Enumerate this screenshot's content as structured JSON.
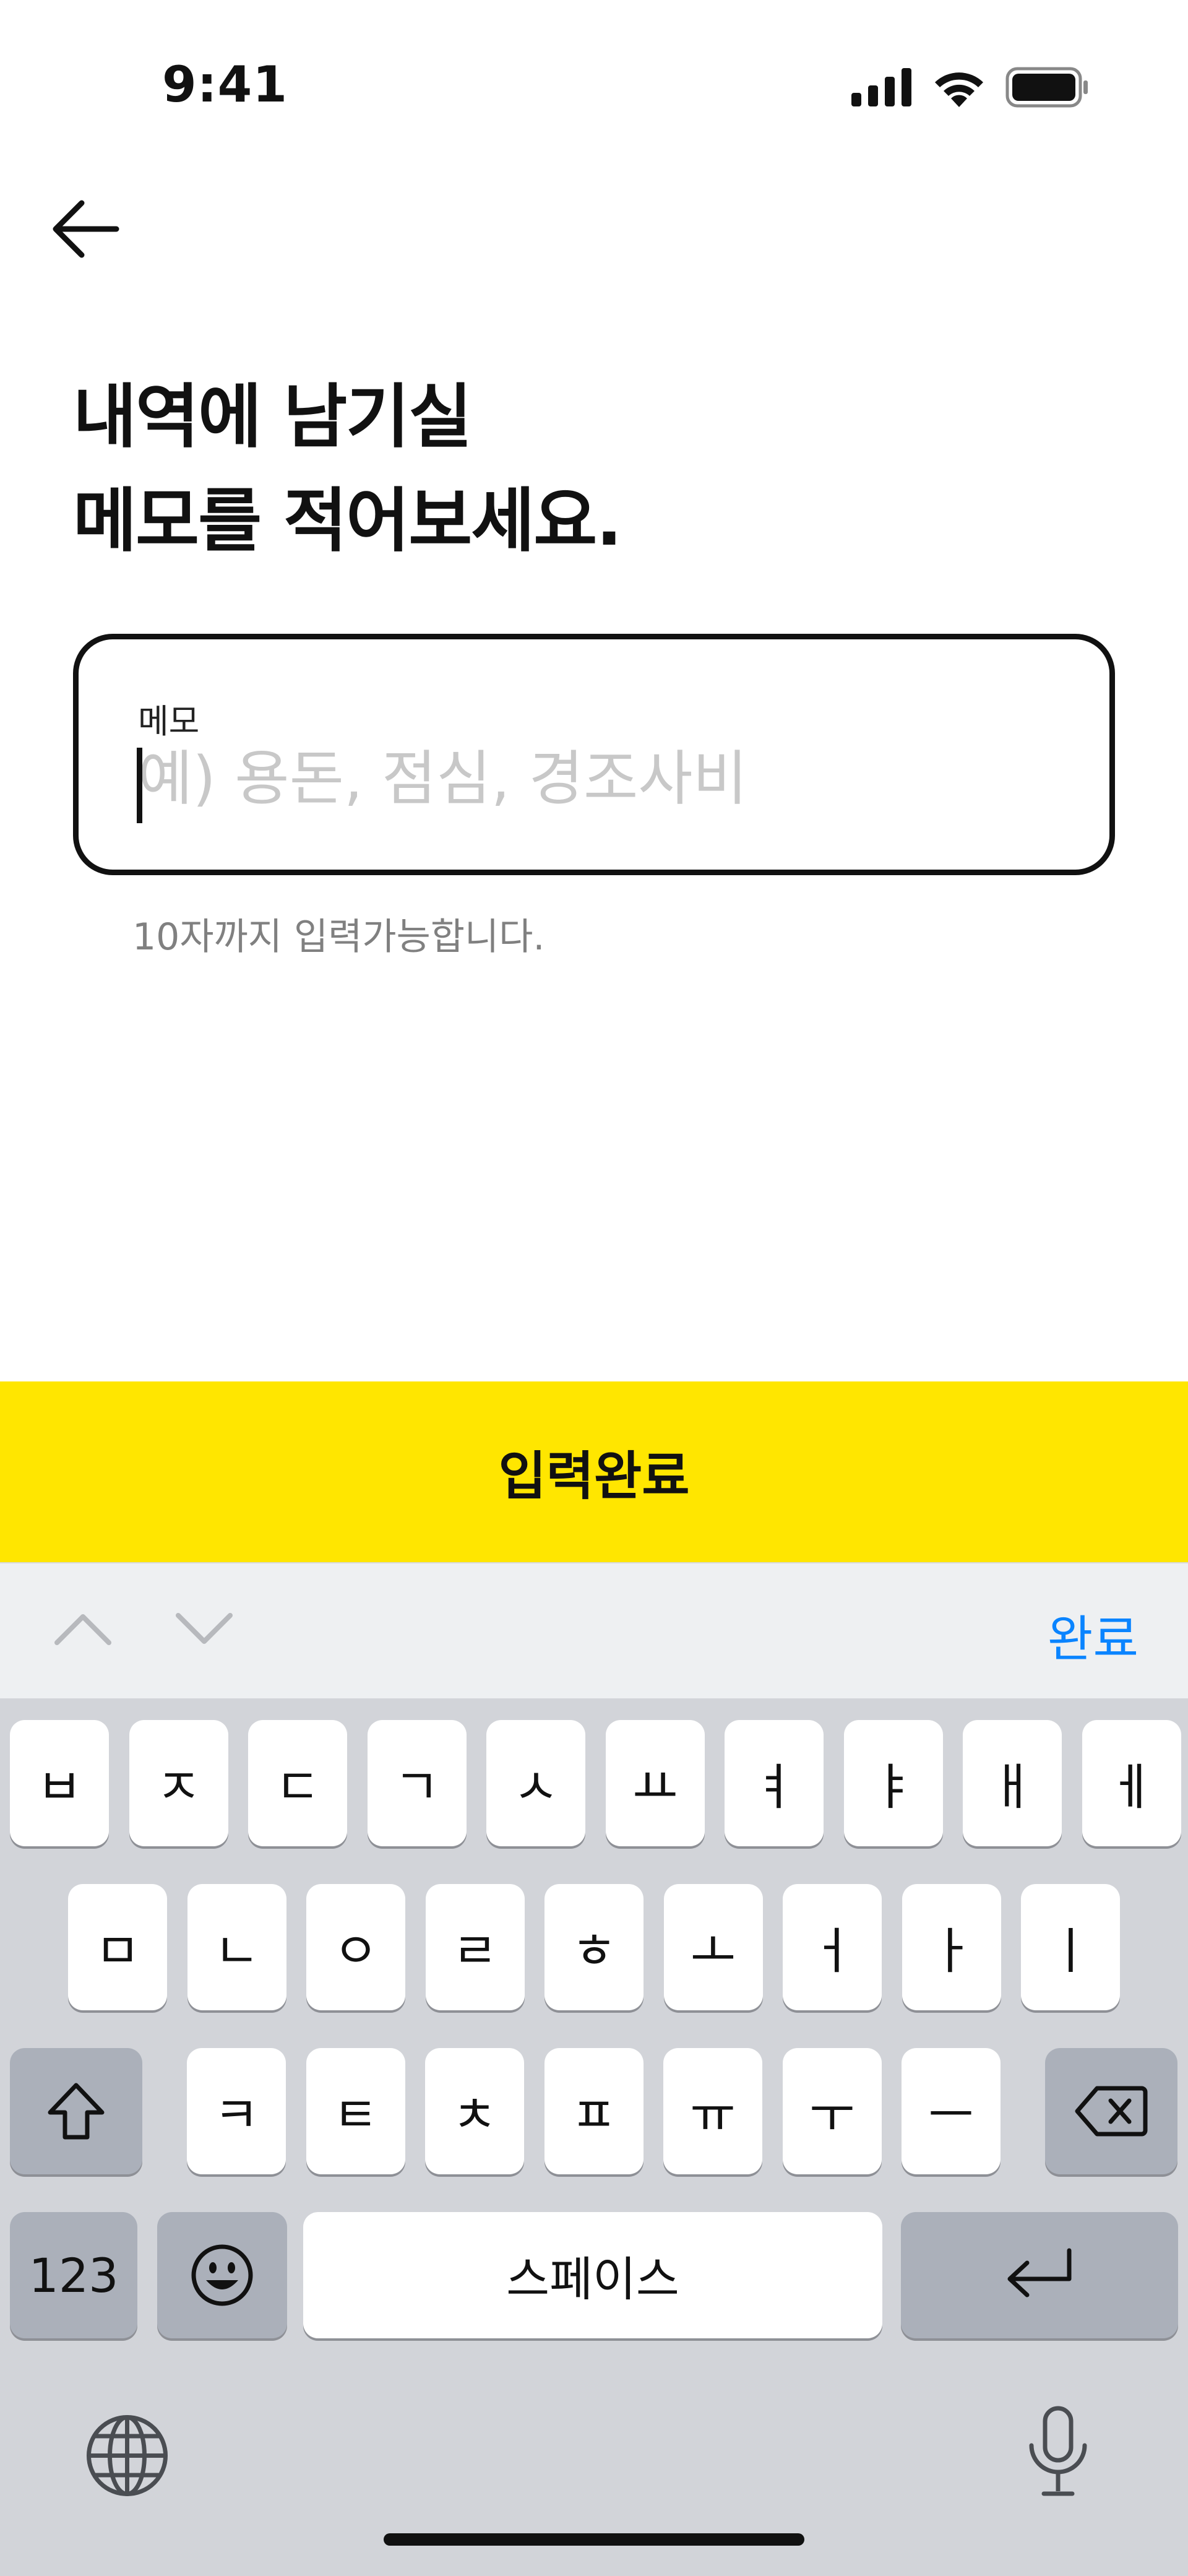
{
  "status_bar": {
    "time": "9:41"
  },
  "page": {
    "title": "내역에 남기실\n메모를 적어보세요.",
    "memo": {
      "label": "메모",
      "value": "",
      "placeholder": "예) 용돈, 점심, 경조사비",
      "helper": "10자까지 입력가능합니다."
    },
    "confirm_label": "입력완료"
  },
  "accessory": {
    "done_label": "완료"
  },
  "keyboard": {
    "row1": [
      "ㅂ",
      "ㅈ",
      "ㄷ",
      "ㄱ",
      "ㅅ",
      "ㅛ",
      "ㅕ",
      "ㅑ",
      "ㅐ",
      "ㅔ"
    ],
    "row2": [
      "ㅁ",
      "ㄴ",
      "ㅇ",
      "ㄹ",
      "ㅎ",
      "ㅗ",
      "ㅓ",
      "ㅏ",
      "ㅣ"
    ],
    "row3": [
      "ㅋ",
      "ㅌ",
      "ㅊ",
      "ㅍ",
      "ㅠ",
      "ㅜ",
      "ㅡ"
    ],
    "numbers_label": "123",
    "space_label": "스페이스"
  },
  "icons": {
    "back": "arrow-left-icon",
    "shift": "shift-icon",
    "delete": "backspace-icon",
    "emoji": "emoji-icon",
    "return": "return-icon",
    "globe": "globe-icon",
    "mic": "microphone-icon"
  },
  "colors": {
    "accent": "#ffe600",
    "link": "#0a84ff",
    "keyboard_bg": "#d2d4d9"
  }
}
